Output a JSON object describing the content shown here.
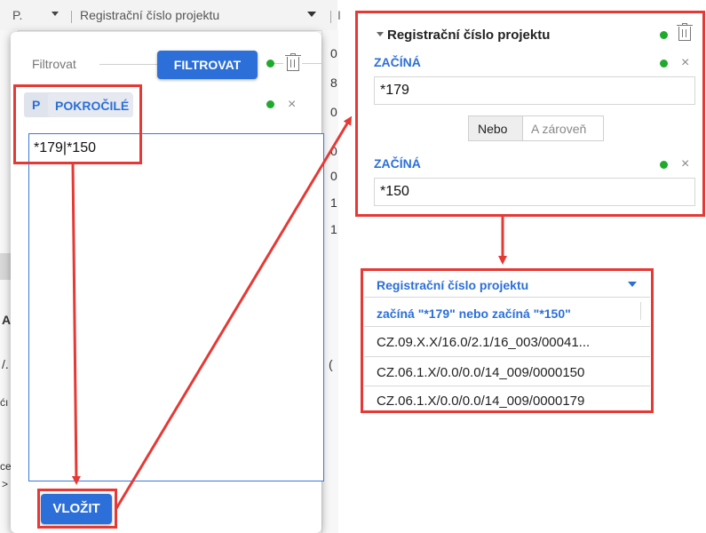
{
  "grid": {
    "header_col_short": "P.",
    "header_title": "Registrační číslo projektu",
    "header_right_char": "I",
    "right_edge_fragments": [
      "0",
      "8",
      "0",
      "0",
      "0",
      "1",
      "1",
      "("
    ],
    "left_edge_fragments": [
      "A",
      "/.",
      "ćı",
      "ce",
      ">"
    ]
  },
  "filter_popup": {
    "filter_label": "Filtrovat",
    "filter_button": "FILTROVAT",
    "tab_prefix": "P",
    "advanced_button": "POKROČILÉ",
    "textarea_value": "*179|*150",
    "insert_button": "VLOŽIT"
  },
  "filter_panel": {
    "title": "Registrační číslo projektu",
    "condition1": {
      "operator": "ZAČÍNÁ",
      "value": "*179"
    },
    "logic": {
      "or": "Nebo",
      "and": "A zároveň",
      "selected": "Nebo"
    },
    "condition2": {
      "operator": "ZAČÍNÁ",
      "value": "*150"
    }
  },
  "result": {
    "column_title": "Registrační číslo projektu",
    "filter_summary": "začíná \"*179\"  nebo začíná \"*150\"",
    "rows": [
      "CZ.09.X.X/16.0/2.1/16_003/00041...",
      "CZ.06.1.X/0.0/0.0/14_009/0000150",
      "CZ.06.1.X/0.0/0.0/14_009/0000179"
    ]
  },
  "colors": {
    "accent_blue": "#2c6fd8",
    "highlight_red": "#e53935",
    "status_green": "#1faa2d"
  },
  "icons": [
    "trash-icon",
    "close-icon",
    "status-dot-icon",
    "dropdown-arrow-icon",
    "collapse-triangle-icon"
  ]
}
